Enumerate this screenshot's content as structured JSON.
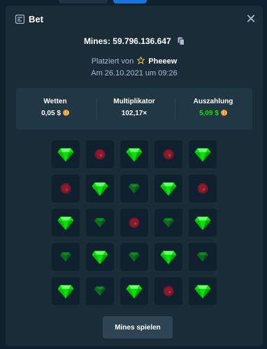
{
  "modal": {
    "title": "Bet",
    "close_label": "✕",
    "mines_id": "Mines: 59.796.136.647",
    "placed_by_prefix": "Platziert von",
    "placed_by_user": "Pheeew",
    "date_line": "Am 26.10.2021 um 09:26",
    "stats": [
      {
        "label": "Wetten",
        "value": "0,05 $",
        "currency_icon": "coin-icon",
        "color": "#ffffff"
      },
      {
        "label": "Multiplikator",
        "value": "102,17×",
        "currency_icon": "",
        "color": "#ffffff"
      },
      {
        "label": "Auszahlung",
        "value": "5,09 $",
        "currency_icon": "coin-icon",
        "color": "#00e701"
      }
    ],
    "grid": {
      "columns": 5,
      "rows": 5,
      "tiles": [
        "gem",
        "mine",
        "gem",
        "mine",
        "gem",
        "mine",
        "gem",
        "gem-faded",
        "gem",
        "mine",
        "gem",
        "gem-faded",
        "mine",
        "gem-faded",
        "gem",
        "gem-faded",
        "gem",
        "gem-faded",
        "gem",
        "gem-faded",
        "gem",
        "gem-faded",
        "gem",
        "mine",
        "gem"
      ]
    },
    "play_button_label": "Mines spielen"
  },
  "colors": {
    "background": "#0f212e",
    "modal": "#1a2c38",
    "panel": "#213743",
    "gem": "#00e701",
    "mine": "#8b1a2b",
    "star": "#f2c94c"
  }
}
